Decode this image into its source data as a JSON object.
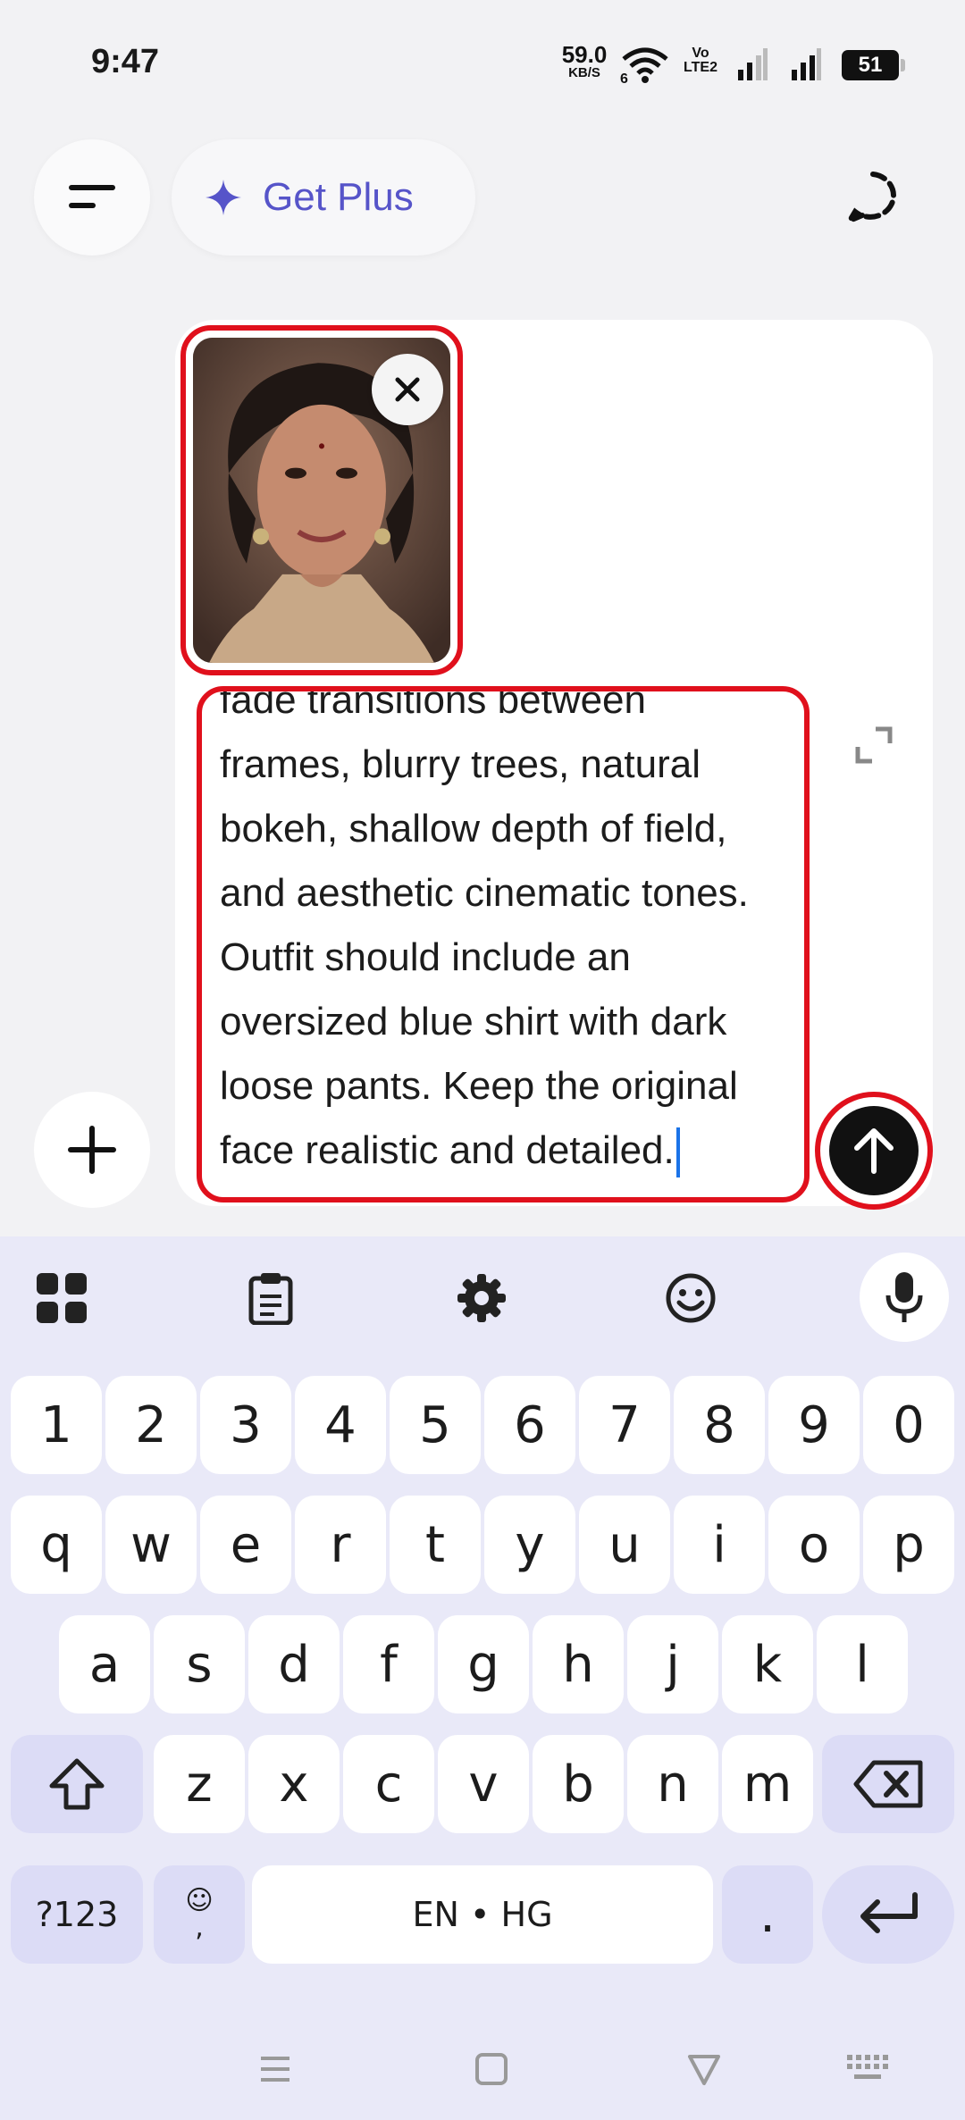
{
  "status_bar": {
    "time": "9:47",
    "net_speed_value": "59.0",
    "net_speed_unit": "KB/S",
    "wifi_badge": "6",
    "volte_top": "Vo",
    "volte_bottom": "LTE2",
    "battery": "51"
  },
  "header": {
    "menu_icon": "menu-icon",
    "upgrade_label": "Get Plus",
    "upgrade_icon": "sparkle-icon",
    "new_chat_icon": "temporary-chat-icon",
    "accent_color": "#5654c9"
  },
  "composer": {
    "prompt_text": "fade transitions between\nframes, blurry trees, natural\nbokeh, shallow depth of field,\nand aesthetic cinematic tones.\nOutfit should include an\noversized blue shirt with dark\nloose pants. Keep the original\nface realistic and detailed.",
    "attachment_icon": "plus-icon",
    "send_icon": "arrow-up-icon",
    "expand_icon": "expand-icon",
    "remove_icon": "close-icon",
    "highlight_color": "#e0101c"
  },
  "keyboard": {
    "toolbar": [
      "apps-icon",
      "clipboard-icon",
      "settings-icon",
      "emoji-icon",
      "mic-icon"
    ],
    "number_row": [
      "1",
      "2",
      "3",
      "4",
      "5",
      "6",
      "7",
      "8",
      "9",
      "0"
    ],
    "row1": [
      "q",
      "w",
      "e",
      "r",
      "t",
      "y",
      "u",
      "i",
      "o",
      "p"
    ],
    "row2": [
      "a",
      "s",
      "d",
      "f",
      "g",
      "h",
      "j",
      "k",
      "l"
    ],
    "row3": [
      "z",
      "x",
      "c",
      "v",
      "b",
      "n",
      "m"
    ],
    "symbols_key": "?123",
    "emoji_comma_top": "☺",
    "emoji_comma_bottom": ",",
    "space_label": "EN • HG",
    "period_key": ".",
    "shift_icon": "shift-icon",
    "backspace_icon": "backspace-icon",
    "enter_icon": "enter-icon"
  },
  "nav_bar": [
    "recents-icon",
    "home-icon",
    "back-icon",
    "keyboard-switch-icon"
  ]
}
